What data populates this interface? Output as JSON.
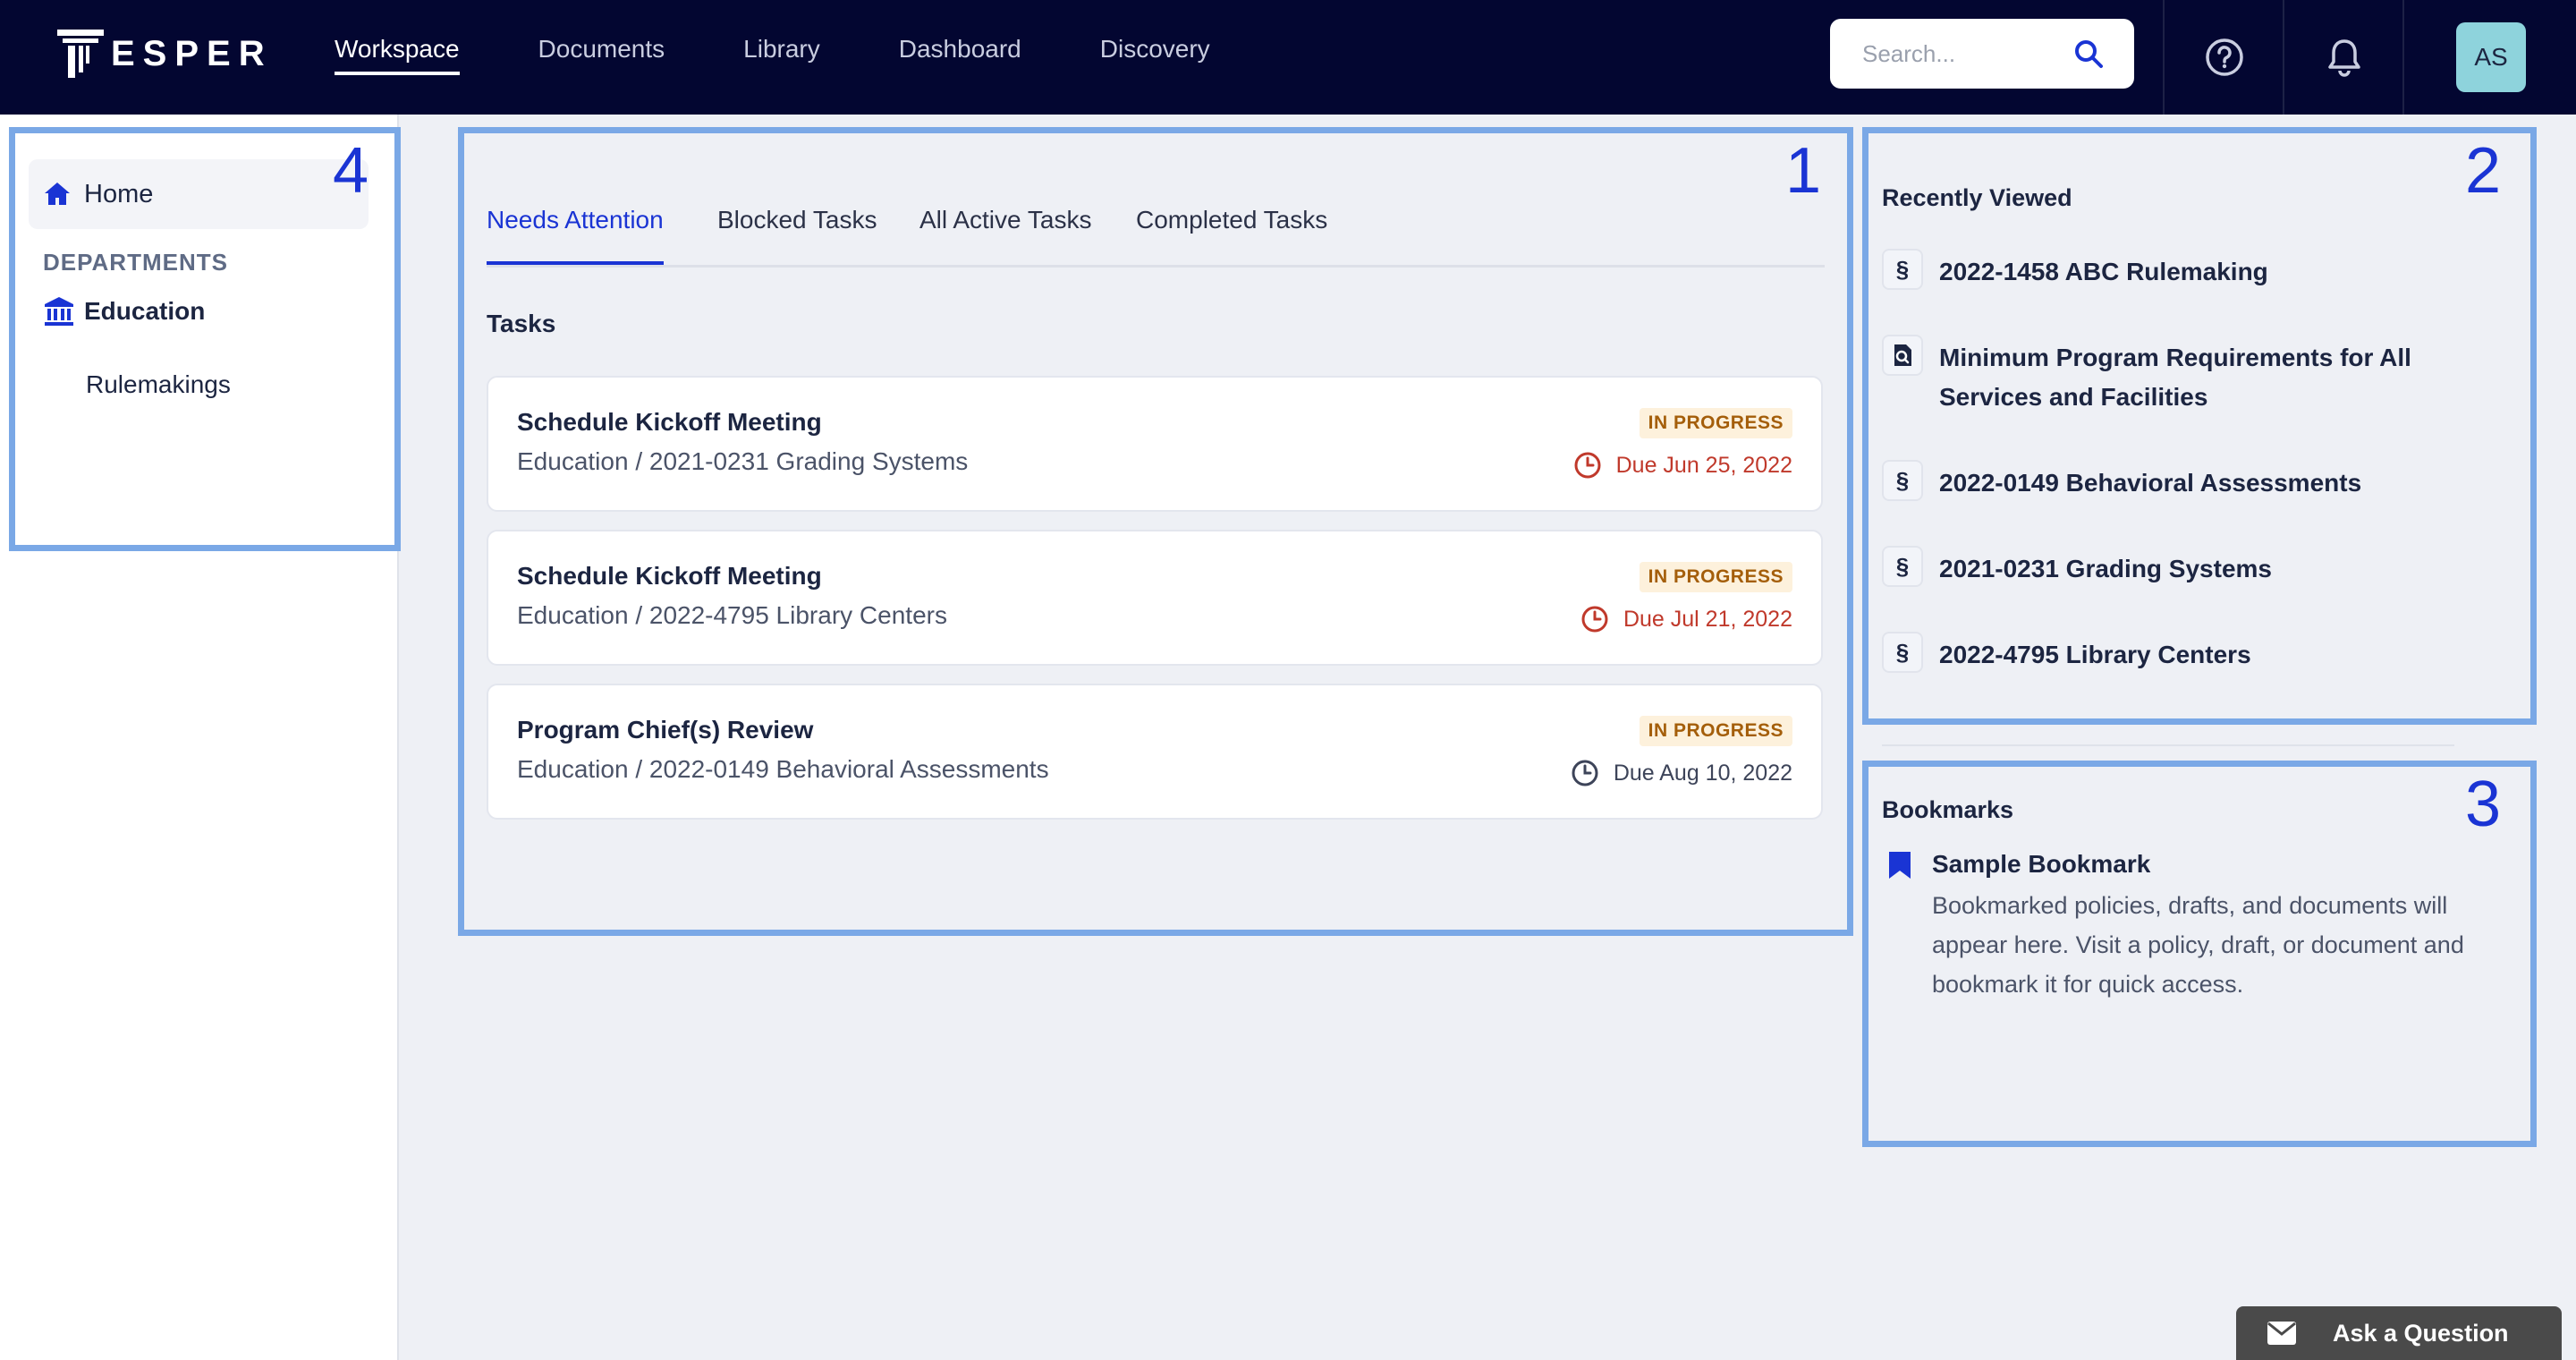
{
  "header": {
    "logo_text": "ESPER",
    "nav": [
      {
        "label": "Workspace",
        "active": true
      },
      {
        "label": "Documents"
      },
      {
        "label": "Library"
      },
      {
        "label": "Dashboard"
      },
      {
        "label": "Discovery"
      }
    ],
    "search_placeholder": "Search...",
    "avatar_initials": "AS"
  },
  "sidebar": {
    "home_label": "Home",
    "departments_label": "DEPARTMENTS",
    "department": "Education",
    "sub_item": "Rulemakings",
    "annotation": "4"
  },
  "main": {
    "annotation": "1",
    "tabs": [
      {
        "label": "Needs Attention",
        "active": true
      },
      {
        "label": "Blocked Tasks"
      },
      {
        "label": "All Active Tasks"
      },
      {
        "label": "Completed Tasks"
      }
    ],
    "section_title": "Tasks",
    "tasks": [
      {
        "title": "Schedule Kickoff Meeting",
        "subtitle": "Education / 2021-0231 Grading Systems",
        "status": "IN PROGRESS",
        "due": "Due Jun 25, 2022",
        "overdue": true
      },
      {
        "title": "Schedule Kickoff Meeting",
        "subtitle": "Education / 2022-4795 Library Centers",
        "status": "IN PROGRESS",
        "due": "Due Jul 21, 2022",
        "overdue": true
      },
      {
        "title": "Program Chief(s) Review",
        "subtitle": "Education / 2022-0149 Behavioral Assessments",
        "status": "IN PROGRESS",
        "due": "Due Aug 10, 2022",
        "overdue": false
      }
    ]
  },
  "recently_viewed": {
    "annotation": "2",
    "title": "Recently Viewed",
    "items": [
      {
        "icon": "section-icon",
        "glyph": "§",
        "label": "2022-1458 ABC Rulemaking"
      },
      {
        "icon": "document-search-icon",
        "glyph": "",
        "label": "Minimum Program Requirements for All Services and Facilities"
      },
      {
        "icon": "section-icon",
        "glyph": "§",
        "label": "2022-0149 Behavioral Assessments"
      },
      {
        "icon": "section-icon",
        "glyph": "§",
        "label": "2021-0231 Grading Systems"
      },
      {
        "icon": "section-icon",
        "glyph": "§",
        "label": "2022-4795 Library Centers"
      }
    ]
  },
  "bookmarks": {
    "annotation": "3",
    "title": "Bookmarks",
    "name": "Sample Bookmark",
    "description": "Bookmarked policies, drafts, and documents will appear here. Visit a policy, draft, or document and bookmark it for quick access."
  },
  "ask_label": "Ask a Question",
  "colors": {
    "nav_bg": "#030631",
    "accent": "#1a34d4",
    "overdue": "#c0392b",
    "badge_bg": "#fdf1dc",
    "badge_text": "#a45e0a",
    "annotation_border": "#7aa8e6"
  }
}
